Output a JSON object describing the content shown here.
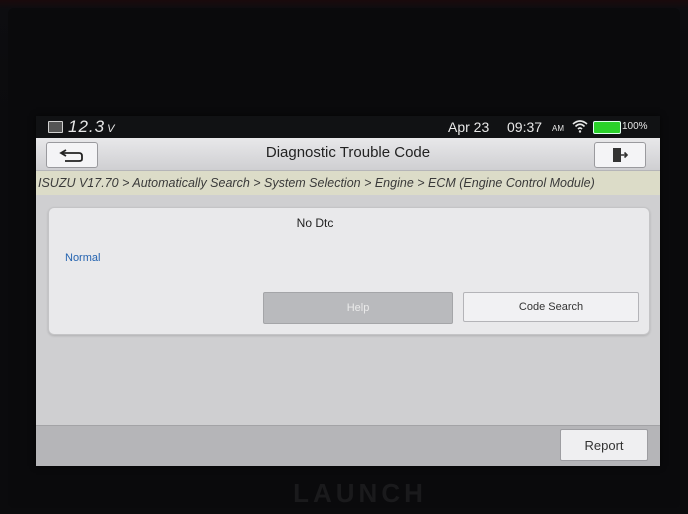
{
  "status_bar": {
    "voltage": "12.3",
    "voltage_unit": "V",
    "date": "Apr 23",
    "time": "09:37",
    "ampm": "AM",
    "battery_percent": "100%"
  },
  "header": {
    "title": "Diagnostic Trouble Code"
  },
  "breadcrumb": "ISUZU V17.70 > Automatically Search > System Selection > Engine > ECM (Engine Control Module)",
  "dtc_card": {
    "title": "No Dtc",
    "status": "Normal",
    "help_label": "Help",
    "code_search_label": "Code Search"
  },
  "footer": {
    "report_label": "Report"
  },
  "device": {
    "brand": "LAUNCH"
  },
  "colors": {
    "status_link": "#2463b0",
    "battery": "#2ad12a"
  }
}
